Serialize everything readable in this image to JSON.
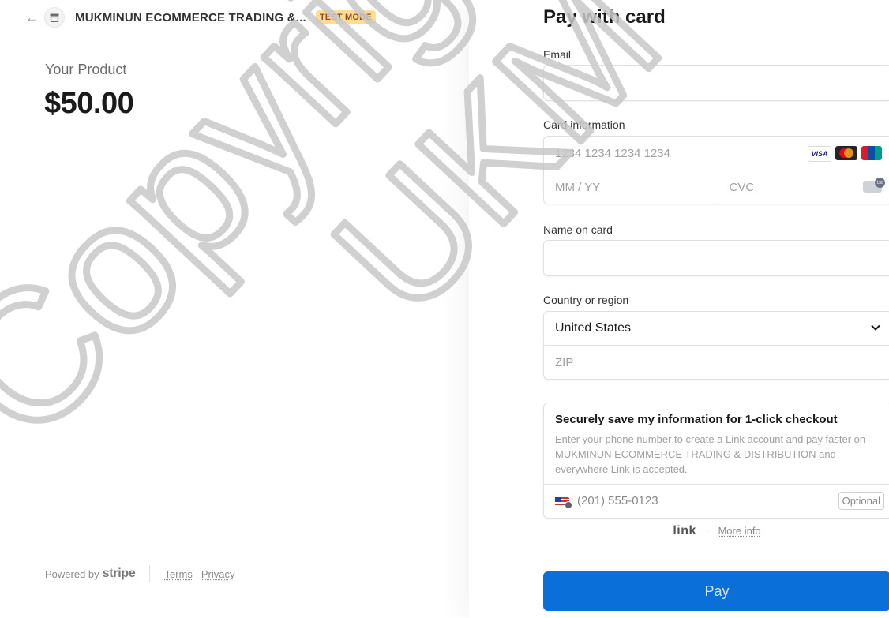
{
  "header": {
    "merchant_name": "MUKMINUN ECOMMERCE TRADING &...",
    "badge": "TEST MODE"
  },
  "product": {
    "name": "Your Product",
    "price": "$50.00"
  },
  "footer": {
    "powered_by": "Powered by",
    "brand": "stripe",
    "terms": "Terms",
    "privacy": "Privacy"
  },
  "form": {
    "title": "Pay with card",
    "email_label": "Email",
    "email_value": "",
    "card_label": "Card information",
    "card_number_placeholder": "1234 1234 1234 1234",
    "expiry_placeholder": "MM / YY",
    "cvc_placeholder": "CVC",
    "card_brands": [
      "VISA",
      "mastercard",
      "UnionPay"
    ],
    "name_label": "Name on card",
    "name_value": "",
    "country_label": "Country or region",
    "country_value": "United States",
    "zip_placeholder": "ZIP"
  },
  "link": {
    "title": "Securely save my information for 1-click checkout",
    "description": "Enter your phone number to create a Link account and pay faster on MUKMINUN ECOMMERCE TRADING & DISTRIBUTION and everywhere Link is accepted.",
    "phone_placeholder": "(201) 555-0123",
    "optional": "Optional",
    "brand": "link",
    "more_info": "More info"
  },
  "pay_button": "Pay",
  "watermark": {
    "line1": "Copyright@",
    "line2": "UKM"
  },
  "colors": {
    "accent": "#0b6fd9",
    "badge_bg": "#ffde92",
    "badge_text": "#a3431f"
  }
}
